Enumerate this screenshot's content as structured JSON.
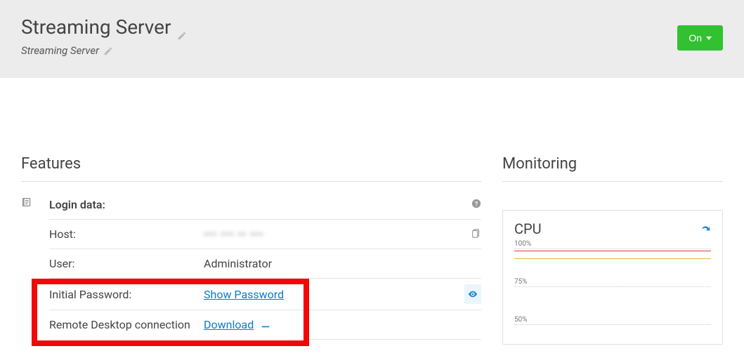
{
  "header": {
    "title": "Streaming Server",
    "subtitle": "Streaming Server",
    "status_button": "On"
  },
  "features": {
    "section_title": "Features",
    "login_data_label": "Login data:",
    "rows": {
      "host_label": "Host:",
      "host_value": "••• ••• •• •••",
      "user_label": "User:",
      "user_value": "Administrator",
      "password_label": "Initial Password:",
      "password_link": "Show Password",
      "rdc_label": "Remote Desktop connection",
      "rdc_link": "Download"
    }
  },
  "monitoring": {
    "section_title": "Monitoring",
    "cpu_title": "CPU",
    "ticks": [
      "100%",
      "75%",
      "50%"
    ]
  }
}
